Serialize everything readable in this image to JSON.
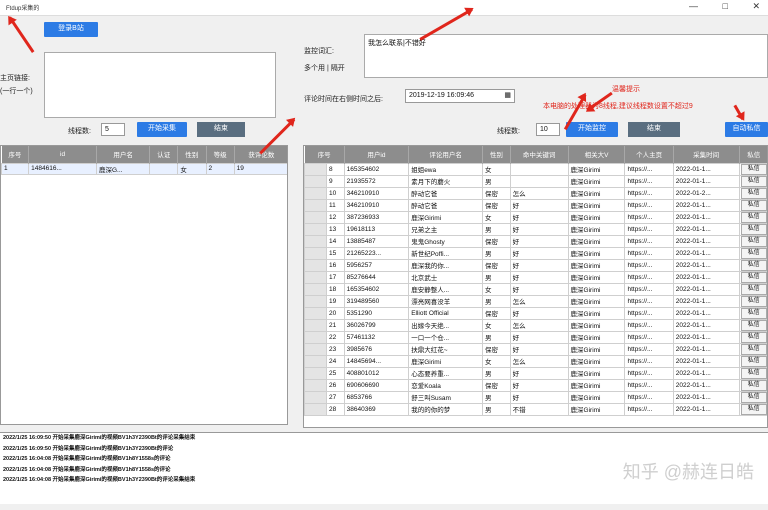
{
  "window": {
    "title": "Ftdup采集的",
    "min": "—",
    "max": "□",
    "close": "✕"
  },
  "top_left": {
    "login_button": "登录B站",
    "homepage_label": "主页链接:",
    "homepage_hint": "(一行一个)"
  },
  "monitor": {
    "words_label": "监控词汇:",
    "words_hint": "多个用 | 隔开",
    "words_value": "我怎么联系|不错好",
    "time_label": "评论时间在右侧时间之后:",
    "time_value": "2019-12-19 16:09:46",
    "calendar_icon": "calendar-icon"
  },
  "notice": {
    "title": "温馨提示",
    "text": "本电脑的处理器为8线程,建议线程数设置不超过9"
  },
  "left_controls": {
    "threads_label": "线程数:",
    "threads_value": "5",
    "start_button": "开始采集",
    "stop_button": "结束"
  },
  "right_controls": {
    "threads_label": "线程数:",
    "threads_value": "10",
    "start_button": "开始监控",
    "stop_button": "结束",
    "auto_button": "自动私信"
  },
  "left_table": {
    "columns": [
      "序号",
      "id",
      "用户名",
      "认证",
      "性别",
      "等级",
      "获评论数"
    ],
    "rows": [
      [
        "1",
        "1484616...",
        "鹿深G...",
        "",
        "女",
        "2",
        "19"
      ]
    ]
  },
  "right_table": {
    "columns": [
      "序号",
      "用户id",
      "评论用户名",
      "性别",
      "命中关键词",
      "相关大V",
      "个人主页",
      "采集时间",
      "私信"
    ],
    "rows": [
      [
        "8",
        "165354602",
        "姐姐ewa",
        "女",
        "",
        "鹿深Girimi",
        "https://...",
        "2022-01-1...",
        "私信"
      ],
      [
        "9",
        "21935572",
        "素月下的蘑火",
        "男",
        "",
        "鹿深Girimi",
        "https://...",
        "2022-01-1...",
        "私信"
      ],
      [
        "10",
        "346210910",
        "醉动它爸",
        "保密",
        "怎么",
        "鹿深Girimi",
        "https://...",
        "2022-01-2...",
        "私信"
      ],
      [
        "11",
        "346210910",
        "醉动它爸",
        "保密",
        "好",
        "鹿深Girimi",
        "https://...",
        "2022-01-1...",
        "私信"
      ],
      [
        "12",
        "387236933",
        "鹿深Girimi",
        "女",
        "好",
        "鹿深Girimi",
        "https://...",
        "2022-01-1...",
        "私信"
      ],
      [
        "13",
        "19618113",
        "兄弟之主",
        "男",
        "好",
        "鹿深Girimi",
        "https://...",
        "2022-01-1...",
        "私信"
      ],
      [
        "14",
        "13885487",
        "鬼鬼Ghosty",
        "保密",
        "好",
        "鹿深Girimi",
        "https://...",
        "2022-01-1...",
        "私信"
      ],
      [
        "15",
        "21265223...",
        "新世纪Poffi...",
        "男",
        "好",
        "鹿深Girimi",
        "https://...",
        "2022-01-1...",
        "私信"
      ],
      [
        "16",
        "5956257",
        "鹿深我的你...",
        "保密",
        "好",
        "鹿深Girimi",
        "https://...",
        "2022-01-1...",
        "私信"
      ],
      [
        "17",
        "85276644",
        "北京武士",
        "男",
        "好",
        "鹿深Girimi",
        "https://...",
        "2022-01-1...",
        "私信"
      ],
      [
        "18",
        "165354602",
        "鹿安静整人...",
        "女",
        "好",
        "鹿深Girimi",
        "https://...",
        "2022-01-1...",
        "私信"
      ],
      [
        "19",
        "319489560",
        "漂亮网喜没羊",
        "男",
        "怎么",
        "鹿深Girimi",
        "https://...",
        "2022-01-1...",
        "私信"
      ],
      [
        "20",
        "5351290",
        "Elliott Official",
        "保密",
        "好",
        "鹿深Girimi",
        "https://...",
        "2022-01-1...",
        "私信"
      ],
      [
        "21",
        "36026799",
        "出嫁今天绝...",
        "女",
        "怎么",
        "鹿深Girimi",
        "https://...",
        "2022-01-1...",
        "私信"
      ],
      [
        "22",
        "57461132",
        "一口一个仓...",
        "男",
        "好",
        "鹿深Girimi",
        "https://...",
        "2022-01-1...",
        "私信"
      ],
      [
        "23",
        "3985676",
        "扶鼎大红花~",
        "保密",
        "好",
        "鹿深Girimi",
        "https://...",
        "2022-01-1...",
        "私信"
      ],
      [
        "24",
        "14845694...",
        "鹿深Girimi",
        "女",
        "怎么",
        "鹿深Girimi",
        "https://...",
        "2022-01-1...",
        "私信"
      ],
      [
        "25",
        "408801012",
        "心态要养重...",
        "男",
        "好",
        "鹿深Girimi",
        "https://...",
        "2022-01-1...",
        "私信"
      ],
      [
        "26",
        "690606690",
        "恋爱Koala",
        "保密",
        "好",
        "鹿深Girimi",
        "https://...",
        "2022-01-1...",
        "私信"
      ],
      [
        "27",
        "6853766",
        "舒三叫Susam",
        "男",
        "好",
        "鹿深Girimi",
        "https://...",
        "2022-01-1...",
        "私信"
      ],
      [
        "28",
        "38640369",
        "我的的你的梦",
        "男",
        "不错",
        "鹿深Girimi",
        "https://...",
        "2022-01-1...",
        "私信"
      ]
    ]
  },
  "log": [
    "2022/1/25 16:09:50 开始采集鹿深Girimi的视频BV1h3Y2390Bt的评论采集结束",
    "2022/1/25 16:09:50 开始采集鹿深Girimi的视频BV1h3Y2390Bt的评论",
    "2022/1/25 16:04:08 开始采集鹿深Girimi的视频BV1h8Y1558s的评论",
    "2022/1/25 16:04:08 开始采集鹿深Girimi的视频BV1h8Y1558s的评论",
    "2022/1/25 16:04:08 开始采集鹿深Girimi的视频BV1h3Y2390Bt的评论采集结束"
  ],
  "watermark": "知乎 @赫连日皓"
}
